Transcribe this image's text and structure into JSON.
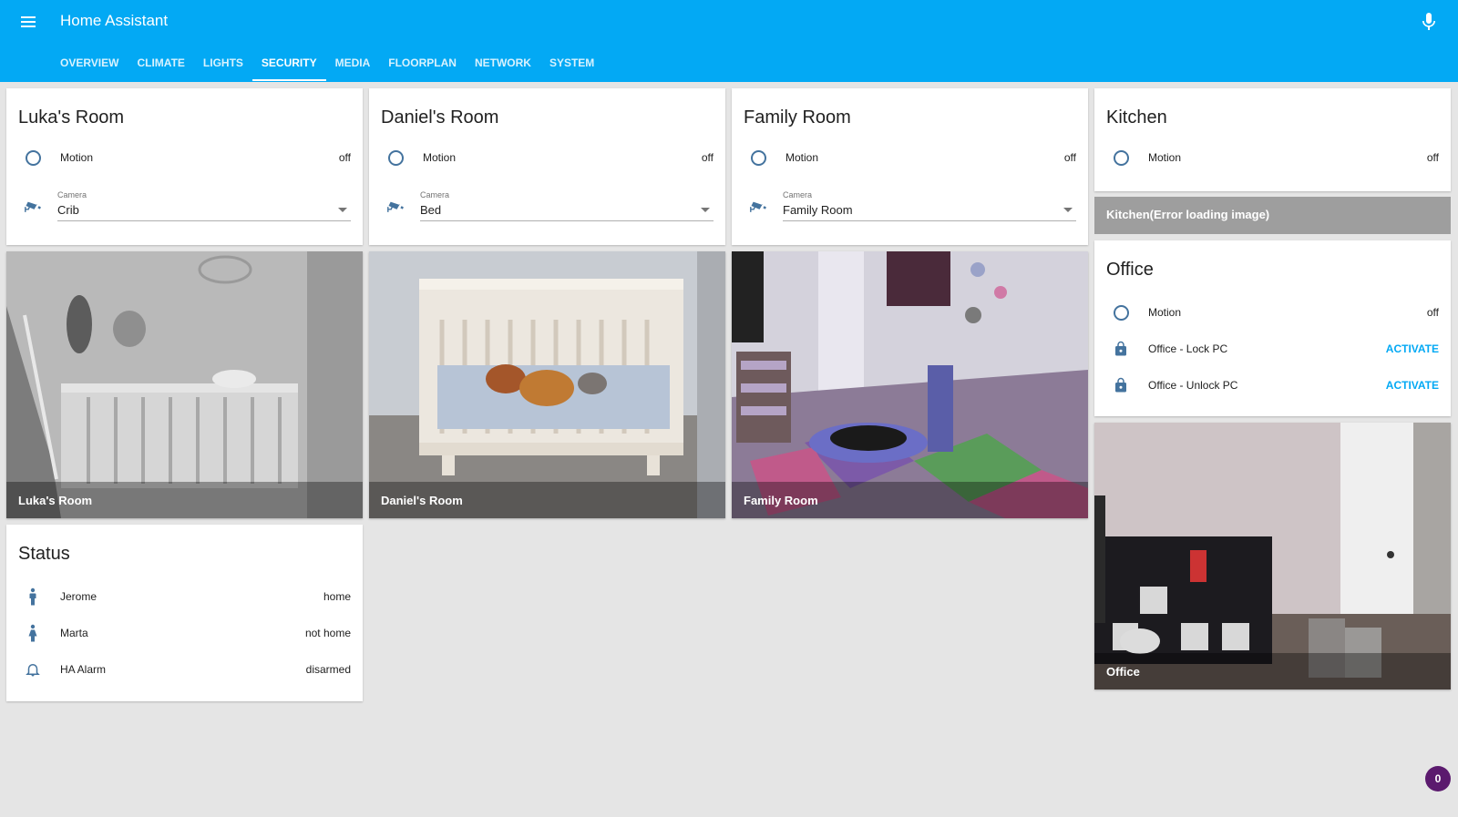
{
  "app": {
    "title": "Home Assistant"
  },
  "colors": {
    "header": "#03a9f4",
    "icon": "#44739e",
    "action": "#03a9f4",
    "background": "#e5e5e5"
  },
  "tabs": [
    {
      "label": "OVERVIEW"
    },
    {
      "label": "CLIMATE"
    },
    {
      "label": "LIGHTS"
    },
    {
      "label": "SECURITY",
      "active": true
    },
    {
      "label": "MEDIA"
    },
    {
      "label": "FLOORPLAN"
    },
    {
      "label": "NETWORK"
    },
    {
      "label": "SYSTEM"
    }
  ],
  "rooms": [
    {
      "title": "Luka's Room",
      "motion_label": "Motion",
      "motion_state": "off",
      "camera_label": "Camera",
      "camera_value": "Crib",
      "camera_caption": "Luka's Room"
    },
    {
      "title": "Daniel's Room",
      "motion_label": "Motion",
      "motion_state": "off",
      "camera_label": "Camera",
      "camera_value": "Bed",
      "camera_caption": "Daniel's Room"
    },
    {
      "title": "Family Room",
      "motion_label": "Motion",
      "motion_state": "off",
      "camera_label": "Camera",
      "camera_value": "Family Room",
      "camera_caption": "Family Room"
    }
  ],
  "kitchen": {
    "title": "Kitchen",
    "motion_label": "Motion",
    "motion_state": "off",
    "camera_error": "Kitchen(Error loading image)"
  },
  "office": {
    "title": "Office",
    "motion_label": "Motion",
    "motion_state": "off",
    "scripts": [
      {
        "name": "Office - Lock PC",
        "action": "ACTIVATE"
      },
      {
        "name": "Office - Unlock PC",
        "action": "ACTIVATE"
      }
    ],
    "camera_caption": "Office"
  },
  "status": {
    "title": "Status",
    "items": [
      {
        "name": "Jerome",
        "state": "home",
        "icon": "person-male-icon"
      },
      {
        "name": "Marta",
        "state": "not home",
        "icon": "person-female-icon"
      },
      {
        "name": "HA Alarm",
        "state": "disarmed",
        "icon": "bell-icon"
      }
    ]
  },
  "notifications": {
    "count": "0"
  }
}
